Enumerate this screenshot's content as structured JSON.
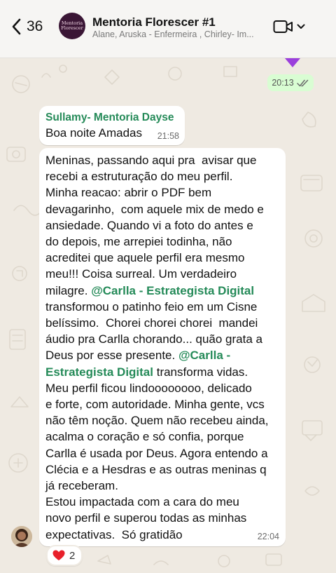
{
  "header": {
    "back_count": "36",
    "group_name": "Mentoria Florescer #1",
    "members": "Alane, Aruska - Enfermeira , Chirley- Im...",
    "avatar_line1": "Mentoria",
    "avatar_line2": "Florescer"
  },
  "outgoing": {
    "time": "20:13"
  },
  "message1": {
    "sender": "Sullamy- Mentoria Dayse",
    "text": "Boa noite Amadas",
    "time": "21:58"
  },
  "message2": {
    "segments": [
      "Meninas, passando aqui pra  avisar que\nrecebi a estruturação do meu perfil.\nMinha reacao: abrir o PDF bem\ndevagarinho,  com aquele mix de medo e\nansiedade. Quando vi a foto do antes e\ndo depois, me arrepiei todinha, não\nacreditei que aquele perfil era mesmo\nmeu!!! Coisa surreal. Um verdadeiro\nmilagre. ",
      "@Carlla - Estrategista Digital",
      "\ntransformou o patinho feio em um Cisne\nbelíssimo.  Chorei chorei chorei  mandei\náudio pra Carlla chorando... quão grata a\nDeus por esse presente. ",
      "@Carlla -\nEstrategista Digital",
      " transforma vidas.\nMeu perfil ficou lindoooooooo, delicado\ne forte, com autoridade. Minha gente, vcs\nnão têm noção. Quem não recebeu ainda,\nacalma o coração e só confia, porque\nCarlla é usada por Deus. Agora entendo a\nClécia e a Hesdras e as outras meninas q\njá receberam.\nEstou impactada com a cara do meu\nnovo perfil e superou todas as minhas\nexpectativas.  Só gratidão"
    ],
    "time": "22:04",
    "reaction_count": "2"
  },
  "icons": {
    "back": "chevron-left-icon",
    "video": "video-camera-icon",
    "read": "double-check-icon",
    "reaction": "heart-icon"
  },
  "colors": {
    "mention": "#248a58",
    "outgoing_bubble": "#d9fdd3",
    "chat_background": "#efeae2"
  }
}
